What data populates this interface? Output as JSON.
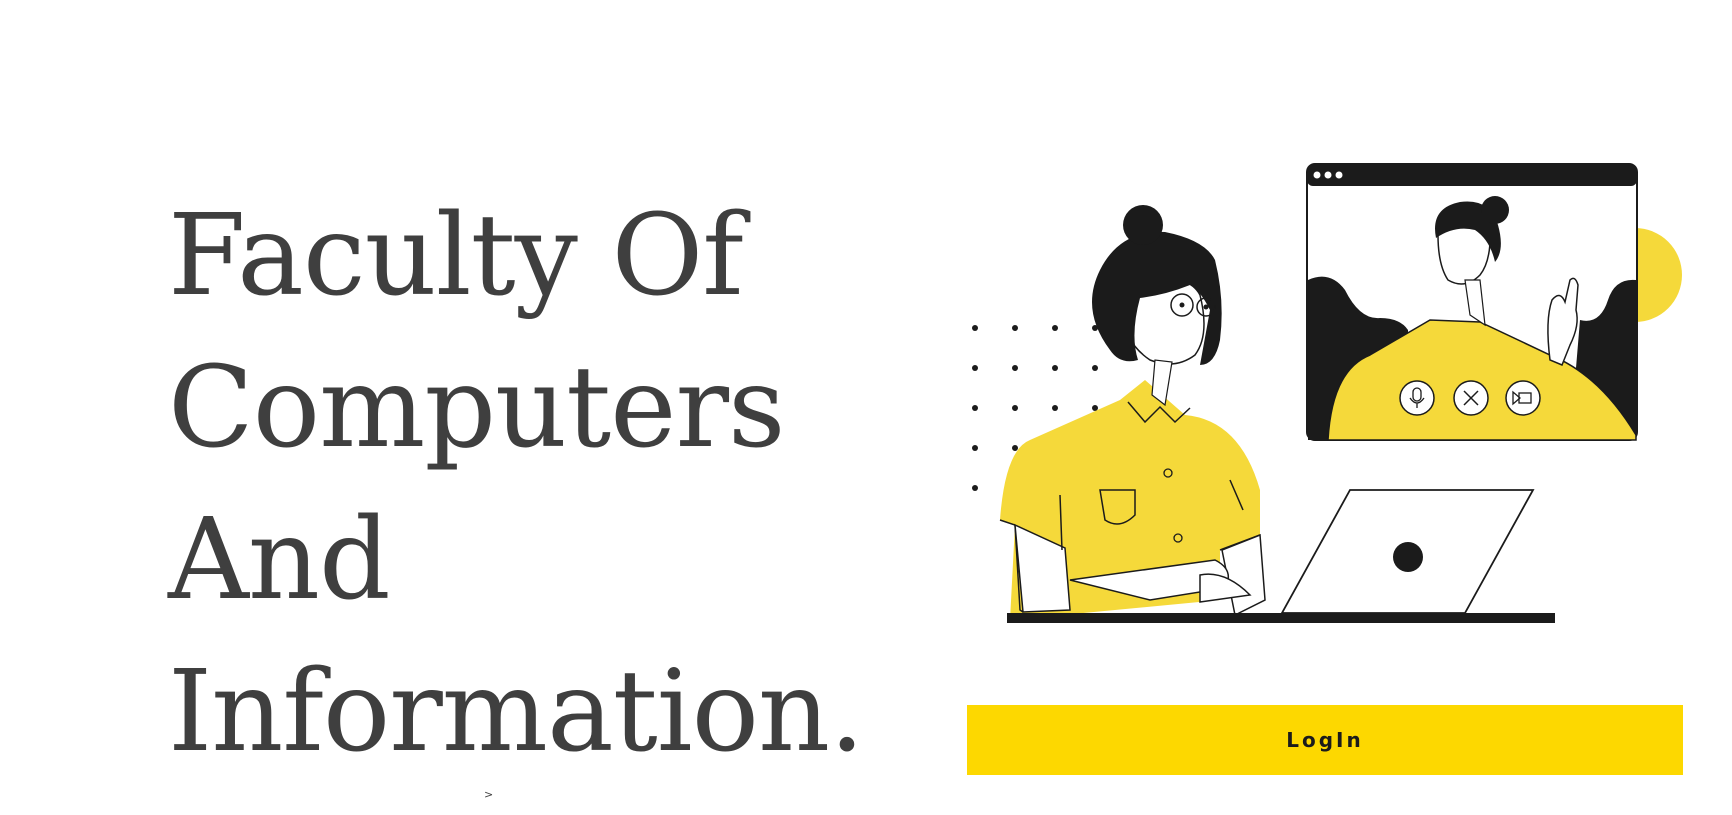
{
  "hero": {
    "line1": "Faculty Of",
    "line2": "Computers",
    "line3": "And",
    "line4": "Information."
  },
  "login_label": "LogIn",
  "caret_text": ">",
  "illustration": {
    "subject": "woman on video call with laptop",
    "icons": [
      "microphone-icon",
      "end-call-icon",
      "camera-icon"
    ]
  },
  "colors": {
    "accent_yellow": "#fdd800",
    "illustration_yellow": "#f5d93a",
    "title_text": "#3f3f3f",
    "dark": "#1b1b1b"
  }
}
